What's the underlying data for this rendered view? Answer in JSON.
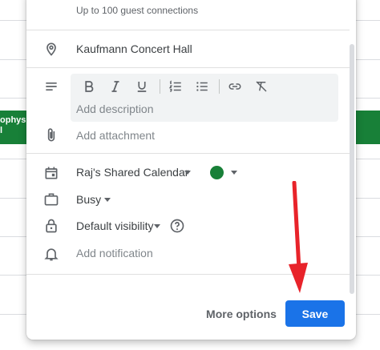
{
  "background": {
    "event_text_line1": "ophysi",
    "event_text_line2": "l",
    "event_color": "#188038"
  },
  "dialog": {
    "conference_subtext": "Up to 100 guest connections",
    "location": {
      "icon": "location-pin-icon",
      "value": "Kaufmann Concert Hall"
    },
    "description": {
      "icon": "notes-icon",
      "toolbar": [
        "bold-icon",
        "italic-icon",
        "underline-icon",
        "numbered-list-icon",
        "bulleted-list-icon",
        "link-icon",
        "clear-formatting-icon"
      ],
      "placeholder": "Add description"
    },
    "attachment": {
      "icon": "paperclip-icon",
      "label": "Add attachment"
    },
    "calendar": {
      "icon": "calendar-icon",
      "value": "Raj's Shared Calendar",
      "color": "#188038"
    },
    "availability": {
      "icon": "briefcase-icon",
      "value": "Busy"
    },
    "visibility": {
      "icon": "lock-icon",
      "value": "Default visibility",
      "help_icon": "help-circle-icon"
    },
    "notification": {
      "icon": "bell-icon",
      "label": "Add notification"
    },
    "footer": {
      "more_options_label": "More options",
      "save_label": "Save",
      "save_color": "#1a73e8"
    },
    "annotation_arrow_color": "#e8232a"
  }
}
